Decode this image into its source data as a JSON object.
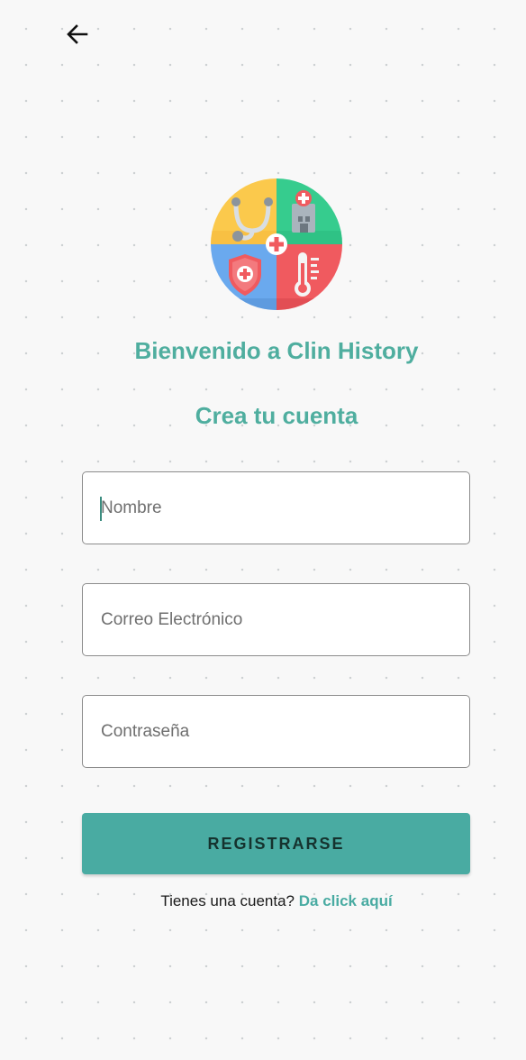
{
  "header": {
    "back_icon": "arrow-left-icon"
  },
  "logo": {
    "icon": "clin-history-medical-logo",
    "colors": {
      "top_left": "#fbc94c",
      "top_right": "#36cc8e",
      "bottom_left": "#6aa9ee",
      "bottom_right": "#f05a5f"
    }
  },
  "welcome_title": "Bienvenido a Clin History",
  "form": {
    "title": "Crea tu cuenta",
    "name_placeholder": "Nombre",
    "email_placeholder": "Correo Electrónico",
    "password_placeholder": "Contraseña",
    "submit_label": "REGISTRARSE"
  },
  "footer": {
    "question": "Tienes una cuenta?",
    "link": "Da click aquí"
  },
  "colors": {
    "accent": "#4fae9f",
    "button": "#49aba2",
    "background": "#f8f8f8"
  }
}
